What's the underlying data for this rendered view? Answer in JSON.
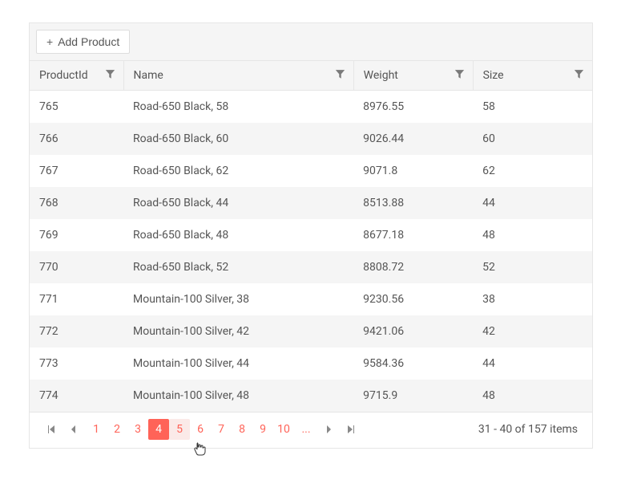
{
  "toolbar": {
    "add_label": "Add Product"
  },
  "columns": [
    {
      "key": "productId",
      "label": "ProductId"
    },
    {
      "key": "name",
      "label": "Name"
    },
    {
      "key": "weight",
      "label": "Weight"
    },
    {
      "key": "size",
      "label": "Size"
    }
  ],
  "rows": [
    {
      "productId": "765",
      "name": "Road-650 Black, 58",
      "weight": "8976.55",
      "size": "58"
    },
    {
      "productId": "766",
      "name": "Road-650 Black, 60",
      "weight": "9026.44",
      "size": "60"
    },
    {
      "productId": "767",
      "name": "Road-650 Black, 62",
      "weight": "9071.8",
      "size": "62"
    },
    {
      "productId": "768",
      "name": "Road-650 Black, 44",
      "weight": "8513.88",
      "size": "44"
    },
    {
      "productId": "769",
      "name": "Road-650 Black, 48",
      "weight": "8677.18",
      "size": "48"
    },
    {
      "productId": "770",
      "name": "Road-650 Black, 52",
      "weight": "8808.72",
      "size": "52"
    },
    {
      "productId": "771",
      "name": "Mountain-100 Silver, 38",
      "weight": "9230.56",
      "size": "38"
    },
    {
      "productId": "772",
      "name": "Mountain-100 Silver, 42",
      "weight": "9421.06",
      "size": "42"
    },
    {
      "productId": "773",
      "name": "Mountain-100 Silver, 44",
      "weight": "9584.36",
      "size": "44"
    },
    {
      "productId": "774",
      "name": "Mountain-100 Silver, 48",
      "weight": "9715.9",
      "size": "48"
    }
  ],
  "pagination": {
    "pages": [
      "1",
      "2",
      "3",
      "4",
      "5",
      "6",
      "7",
      "8",
      "9",
      "10"
    ],
    "selected": "4",
    "hovered": "5",
    "ellipsis": "...",
    "info": "31 - 40 of 157 items"
  }
}
